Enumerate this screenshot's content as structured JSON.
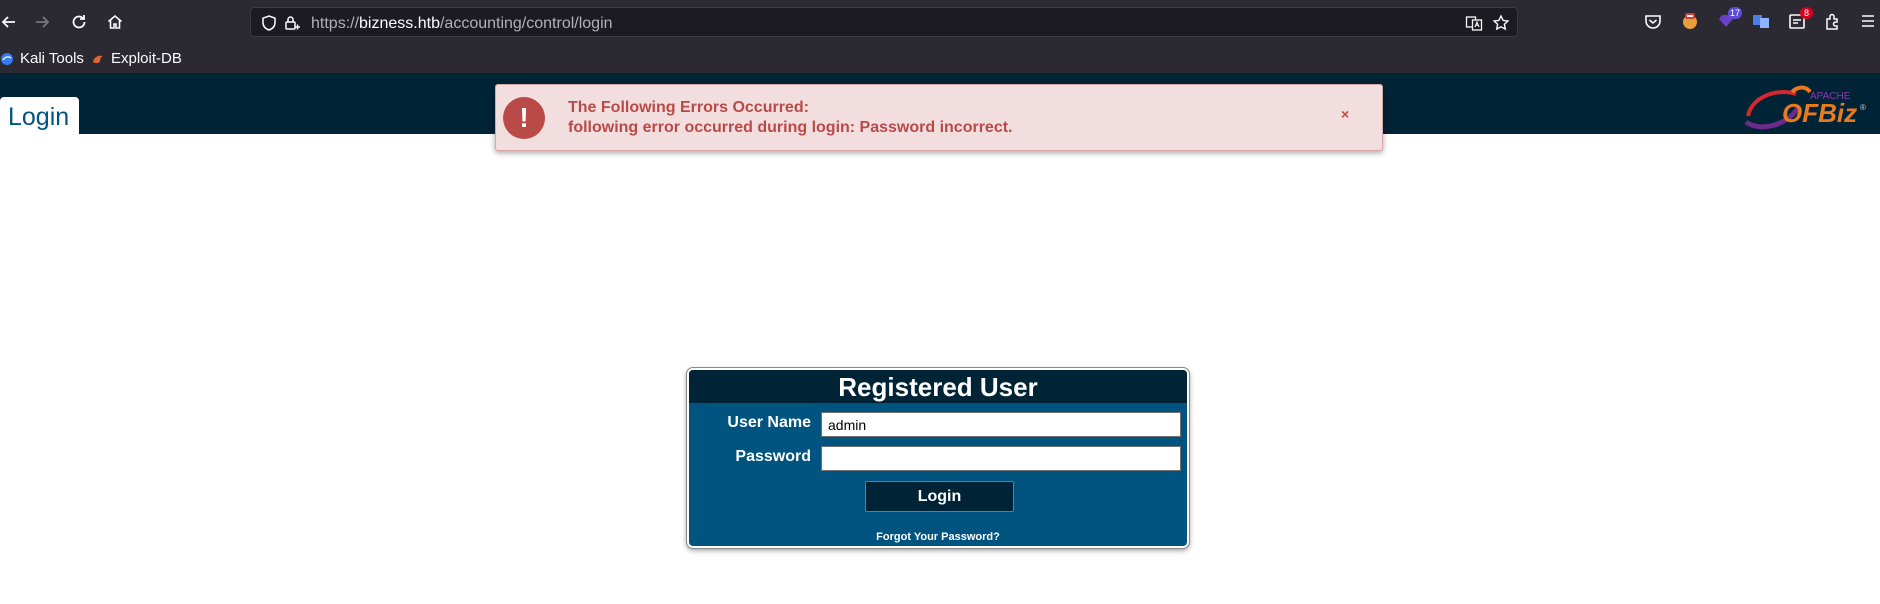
{
  "browser": {
    "url_prefix": "https://",
    "url_host": "bizness.htb",
    "url_path": "/accounting/control/login",
    "badges": {
      "ext_purple": "17",
      "ext_red": "8"
    },
    "bookmarks": [
      {
        "label": "Kali Tools"
      },
      {
        "label": "Exploit-DB"
      }
    ]
  },
  "page": {
    "tab_label": "Login",
    "logo_small": "APACHE",
    "logo_main": "OFBiz",
    "logo_tm": "®"
  },
  "error": {
    "icon": "!",
    "title": "The Following Errors Occurred:",
    "message": "following error occurred during login: Password incorrect.",
    "close": "×"
  },
  "login_form": {
    "title": "Registered User",
    "username_label": "User Name",
    "username_value": "admin",
    "password_label": "Password",
    "password_value": "",
    "submit_label": "Login",
    "forgot_label": "Forgot Your Password?"
  },
  "colors": {
    "header": "#002335",
    "panel": "#00547f",
    "error_bg": "#f2dede",
    "error_text": "#b94a48"
  }
}
